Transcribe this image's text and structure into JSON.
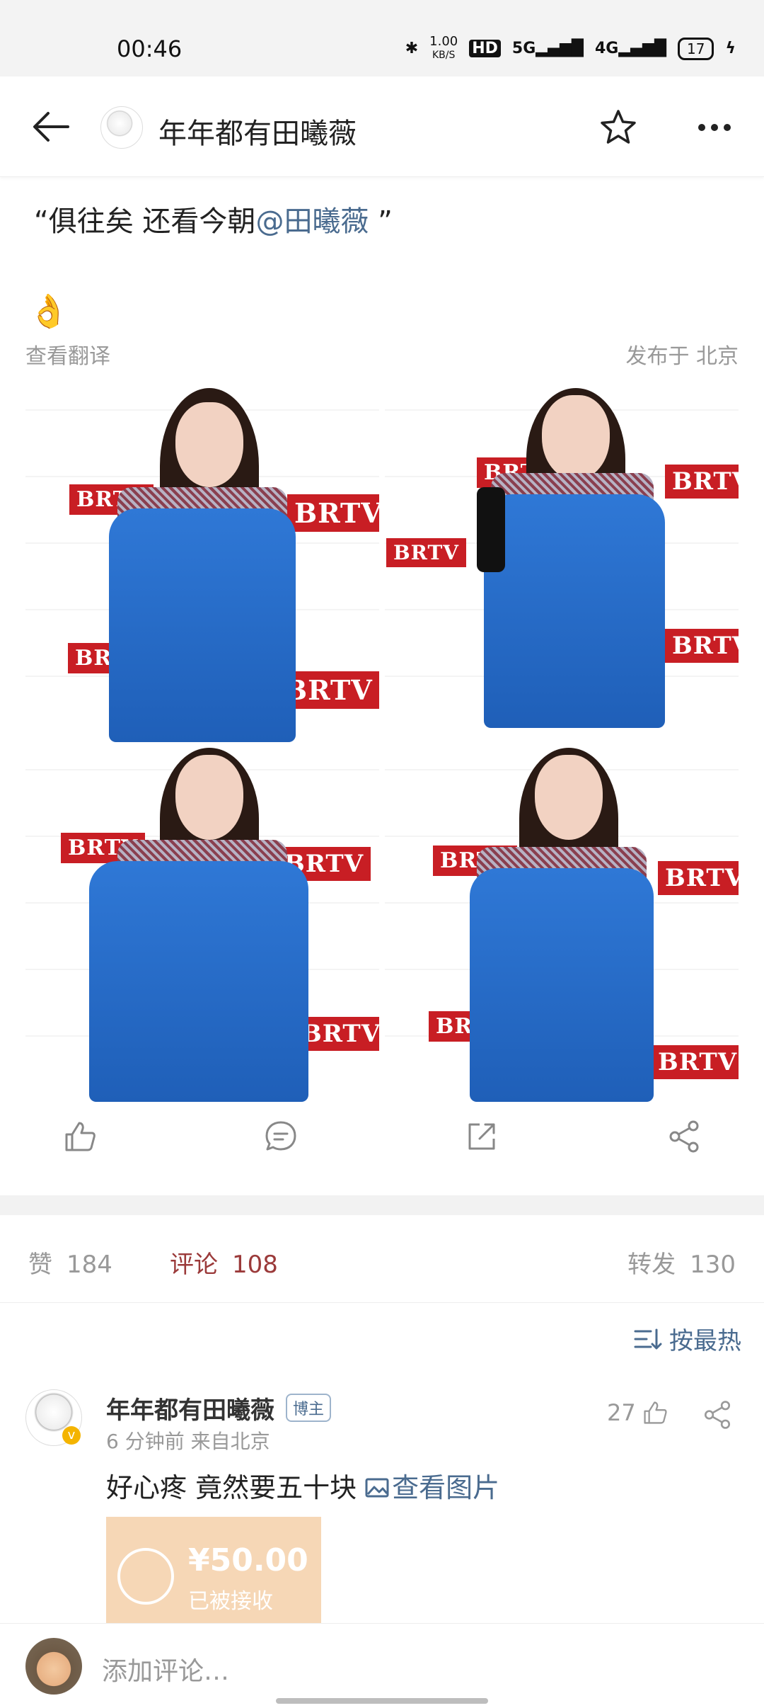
{
  "status_bar": {
    "time": "00:46",
    "net_speed": "1.00",
    "net_speed_unit": "KB/S",
    "hd": "HD",
    "signal1": "5G",
    "signal2": "4G",
    "battery": "17"
  },
  "header": {
    "title": "年年都有田曦薇"
  },
  "post": {
    "quote_open": "“俱往矣 还看今朝",
    "mention": "@田曦薇",
    "quote_close": " ”",
    "emoji": "👌",
    "translate": "查看翻译",
    "location": "发布于 北京",
    "photo_logo": "BRTV"
  },
  "stats": {
    "like_label": "赞",
    "like_count": "184",
    "comment_label": "评论",
    "comment_count": "108",
    "repost_label": "转发",
    "repost_count": "130"
  },
  "sort": {
    "label": "按最热"
  },
  "comment": {
    "name": "年年都有田曦薇",
    "tag": "博主",
    "meta": "6 分钟前  来自北京",
    "likes": "27",
    "text": "好心疼 竟然要五十块 ",
    "image_link": "查看图片",
    "receipt_amount": "¥50.00",
    "receipt_status": "已被接收"
  },
  "bottom": {
    "input_placeholder": "添加评论…"
  }
}
